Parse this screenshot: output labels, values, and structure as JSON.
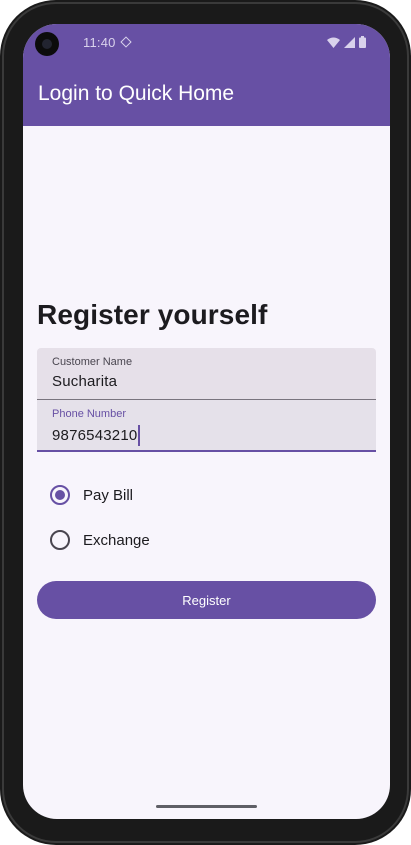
{
  "status_bar": {
    "time": "11:40"
  },
  "app_bar": {
    "title": "Login to Quick Home"
  },
  "form": {
    "heading": "Register yourself",
    "customer_name": {
      "label": "Customer Name",
      "value": "Sucharita"
    },
    "phone_number": {
      "label": "Phone Number",
      "value": "9876543210"
    },
    "options": [
      {
        "label": "Pay Bill",
        "selected": true
      },
      {
        "label": "Exchange",
        "selected": false
      }
    ],
    "register_label": "Register"
  },
  "colors": {
    "primary": "#6750a4",
    "surface": "#f8f5fc",
    "field_background": "#e6e0e9",
    "text": "#1c1b1f"
  },
  "icons": {
    "status": [
      "location-diamond-icon",
      "wifi-icon",
      "cellular-signal-icon",
      "battery-icon"
    ]
  }
}
